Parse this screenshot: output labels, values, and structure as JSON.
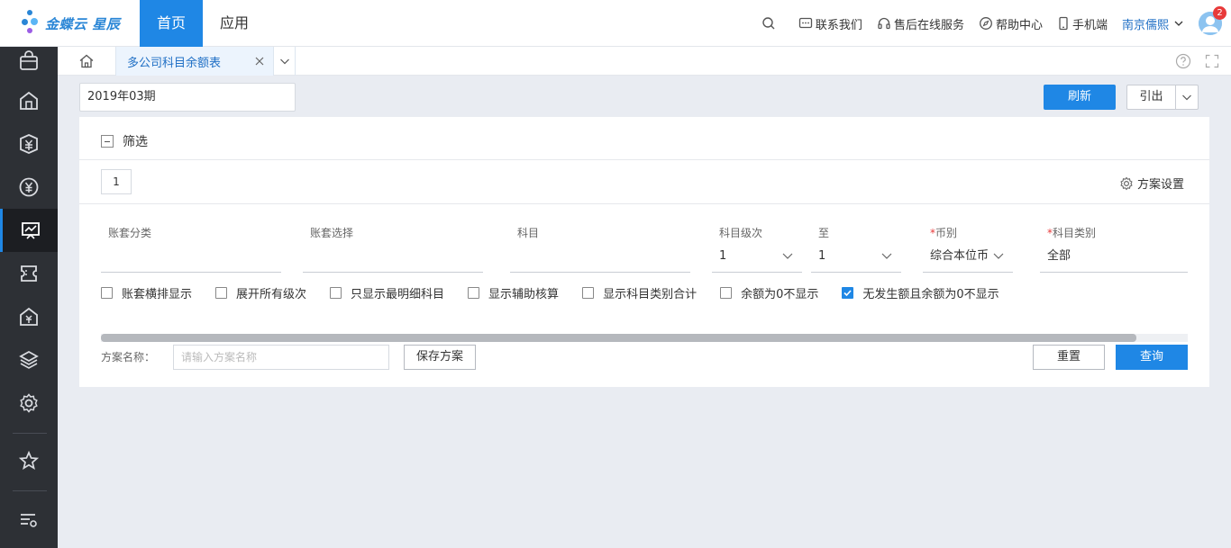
{
  "brand": {
    "logo_text": "金蝶云 星辰"
  },
  "nav": {
    "home": "首页",
    "apps": "应用"
  },
  "top_right": {
    "contact": "联系我们",
    "after_sales": "售后在线服务",
    "help": "帮助中心",
    "mobile": "手机端",
    "user": "南京儒熙",
    "notification_count": "2"
  },
  "sidebar": {
    "items": [
      "shopping-bag-icon",
      "warehouse-icon",
      "finance-icon",
      "yen-icon",
      "report-chart-icon",
      "ticket-icon",
      "asset-icon",
      "layers-icon",
      "settings-icon",
      "star-icon",
      "menu-settings-icon"
    ],
    "active": "report-chart-icon"
  },
  "tabs": {
    "active_label": "多公司科目余额表"
  },
  "toolbar": {
    "period": "2019年03期",
    "refresh": "刷新",
    "export": "引出"
  },
  "filter": {
    "title": "筛选",
    "tab_number": "1",
    "scheme_settings": "方案设置",
    "fields": [
      {
        "label": "账套分类",
        "required": false,
        "value": ""
      },
      {
        "label": "账套选择",
        "required": false,
        "value": ""
      },
      {
        "label": "科目",
        "required": false,
        "value": ""
      },
      {
        "label": "科目级次",
        "required": false,
        "value": "1"
      },
      {
        "label": "至",
        "required": false,
        "value": "1"
      },
      {
        "label": "币别",
        "required": true,
        "value": "综合本位币"
      },
      {
        "label": "科目类别",
        "required": true,
        "value": "全部"
      }
    ],
    "required_mark": "*",
    "checkboxes": [
      {
        "label": "账套横排显示",
        "checked": false
      },
      {
        "label": "展开所有级次",
        "checked": false
      },
      {
        "label": "只显示最明细科目",
        "checked": false
      },
      {
        "label": "显示辅助核算",
        "checked": false
      },
      {
        "label": "显示科目类别合计",
        "checked": false
      },
      {
        "label": "余额为0不显示",
        "checked": false
      },
      {
        "label": "无发生额且余额为0不显示",
        "checked": true
      }
    ],
    "scheme_name_label": "方案名称：",
    "scheme_name_placeholder": "请输入方案名称",
    "save_scheme": "保存方案",
    "reset": "重置",
    "query": "查询"
  },
  "colors": {
    "accent": "#1f87e5",
    "sidebar_bg": "#2d3035",
    "required": "#e83a3a"
  }
}
